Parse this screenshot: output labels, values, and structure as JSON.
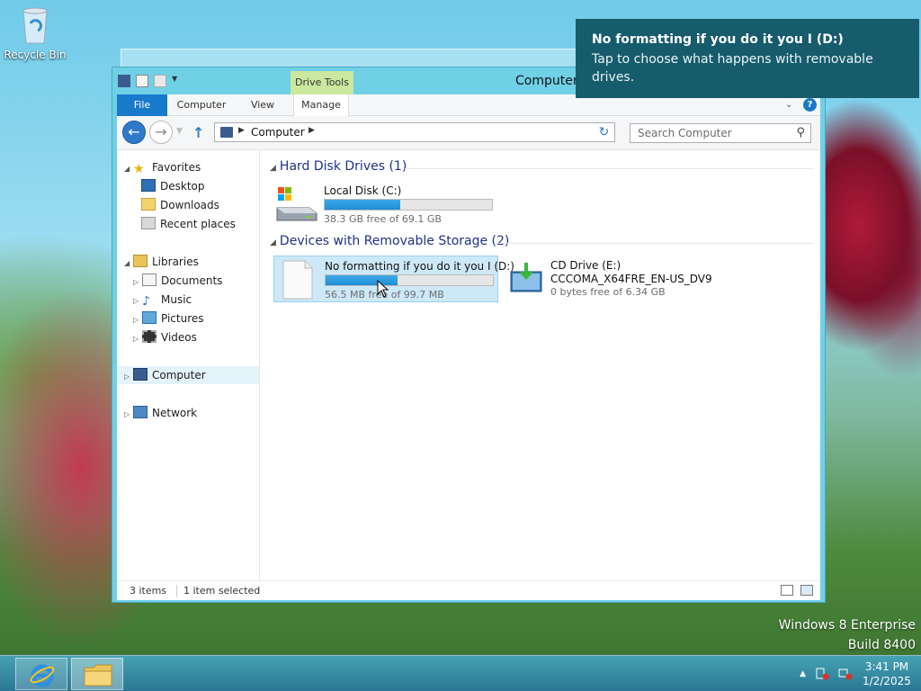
{
  "desktop": {
    "recycle_bin_label": "Recycle Bin"
  },
  "window": {
    "title": "Computer",
    "contextual_tab": "Drive Tools",
    "tabs": [
      {
        "label": "File",
        "active": true
      },
      {
        "label": "Computer"
      },
      {
        "label": "View"
      },
      {
        "label": "Manage"
      }
    ],
    "address": {
      "crumb": "Computer"
    },
    "search": {
      "placeholder": "Search Computer"
    },
    "navpane": {
      "favorites": "Favorites",
      "desktop": "Desktop",
      "downloads": "Downloads",
      "recent": "Recent places",
      "libraries": "Libraries",
      "documents": "Documents",
      "music": "Music",
      "pictures": "Pictures",
      "videos": "Videos",
      "computer": "Computer",
      "network": "Network"
    },
    "groups": {
      "hdd": "Hard Disk Drives (1)",
      "removable": "Devices with Removable Storage (2)"
    },
    "drives": {
      "c": {
        "name": "Local Disk (C:)",
        "free": "38.3 GB free of 69.1 GB",
        "used_fraction": 0.45
      },
      "d": {
        "name": "No formatting if you do it you I (D:)",
        "free": "56.5 MB free of 99.7 MB",
        "used_fraction": 0.43,
        "selected": true
      },
      "e": {
        "name": "CD Drive (E:)",
        "label": "CCCOMA_X64FRE_EN-US_DV9",
        "free": "0 bytes free of 6.34 GB"
      }
    },
    "status": {
      "items": "3 items",
      "selected": "1 item selected"
    }
  },
  "toast": {
    "title": "No formatting if you do it you I (D:)",
    "body": "Tap to choose what happens with removable drives."
  },
  "watermark": {
    "line1": "Windows 8 Enterprise",
    "line2": "Build 8400"
  },
  "taskbar": {
    "time": "3:41 PM",
    "date": "1/2/2025"
  },
  "colors": {
    "accent": "#1979ca",
    "toast_bg": "#175c6c",
    "window_frame": "#6fd0e6",
    "selection": "#cde8f7"
  }
}
